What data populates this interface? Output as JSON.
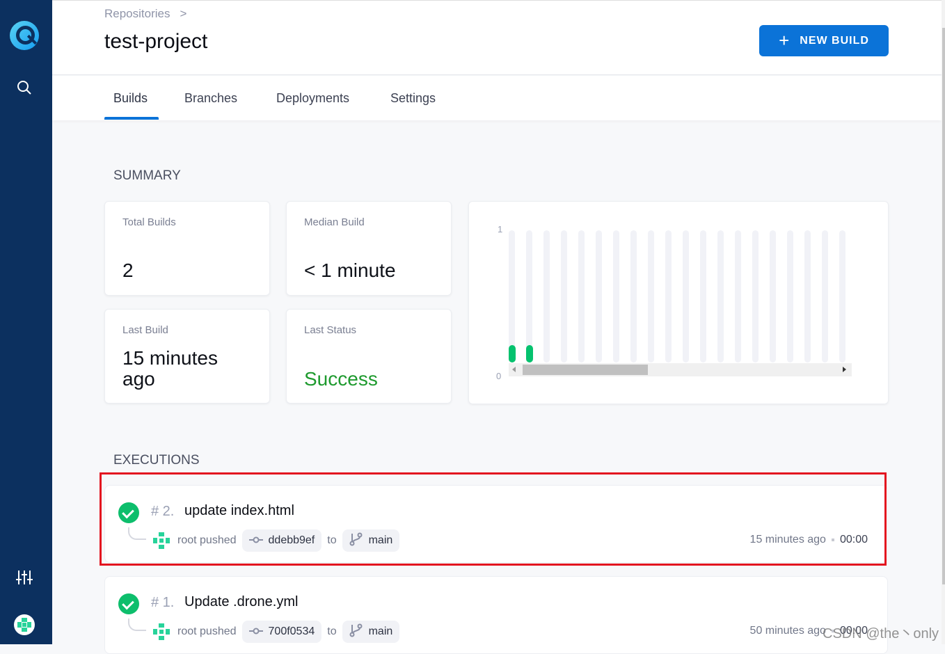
{
  "sidebar": {
    "items": [
      {
        "icon": "drone-logo"
      },
      {
        "icon": "search-icon"
      },
      {
        "icon": "settings-sliders-icon"
      },
      {
        "icon": "user-avatar"
      }
    ]
  },
  "header": {
    "breadcrumb": "Repositories",
    "breadcrumb_sep": ">",
    "title": "test-project",
    "new_build": "NEW BUILD"
  },
  "tabs": [
    {
      "label": "Builds",
      "active": true
    },
    {
      "label": "Branches"
    },
    {
      "label": "Deployments"
    },
    {
      "label": "Settings"
    }
  ],
  "summary": {
    "heading": "SUMMARY",
    "total_builds": {
      "label": "Total Builds",
      "value": "2"
    },
    "median_build": {
      "label": "Median Build",
      "value": "< 1 minute"
    },
    "last_build": {
      "label": "Last Build",
      "value": "15 minutes ago"
    },
    "last_status": {
      "label": "Last Status",
      "value": "Success"
    }
  },
  "chart_data": {
    "type": "bar",
    "y_ticks": [
      "1",
      "0"
    ],
    "ylim": [
      0,
      1
    ],
    "values": [
      0.13,
      0.13,
      0,
      0,
      0,
      0,
      0,
      0,
      0,
      0,
      0,
      0,
      0,
      0,
      0,
      0,
      0,
      0,
      0,
      0
    ],
    "bar_color": "#05c26e",
    "track_color": "#f1f2f7"
  },
  "executions": {
    "heading": "EXECUTIONS",
    "items": [
      {
        "number": "# 2.",
        "message": "update index.html",
        "author": "root pushed",
        "commit": "ddebb9ef",
        "to": "to",
        "branch": "main",
        "time": "15 minutes ago",
        "duration": "00:00",
        "status": "success"
      },
      {
        "number": "# 1.",
        "message": "Update .drone.yml",
        "author": "root pushed",
        "commit": "700f0534",
        "to": "to",
        "branch": "main",
        "time": "50 minutes ago",
        "duration": "00:00",
        "status": "success"
      }
    ]
  },
  "watermark": "CSDN @the丶only",
  "colors": {
    "sidebar": "#0c305f",
    "accent": "#0b73d8",
    "success": "#1e9a2e",
    "highlight": "#e3141f"
  }
}
